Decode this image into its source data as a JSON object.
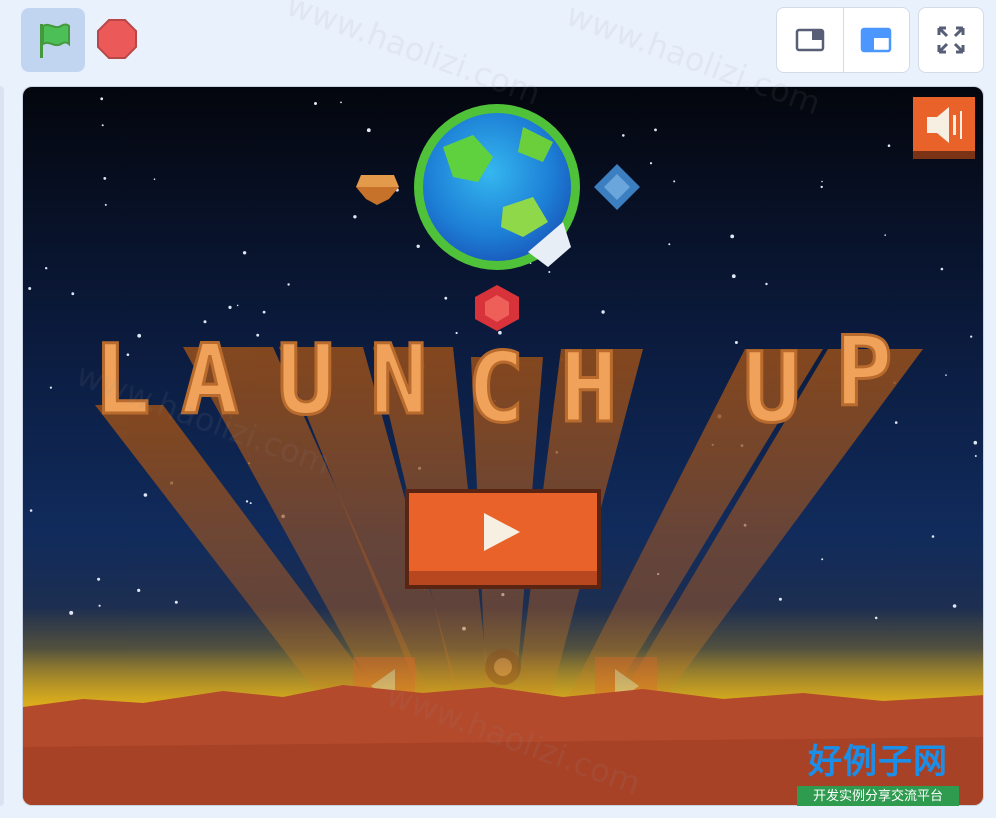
{
  "toolbar": {
    "green_flag": {
      "icon": "green-flag-icon",
      "color": "#4cbf56"
    },
    "stop": {
      "icon": "stop-sign-icon",
      "color": "#ec5959"
    },
    "small_stage": {
      "icon": "small-stage-icon"
    },
    "normal_stage": {
      "icon": "normal-stage-icon",
      "selected": true,
      "accent": "#4c97ff"
    },
    "fullscreen": {
      "icon": "fullscreen-icon"
    }
  },
  "game": {
    "title_letters": [
      "L",
      "A",
      "U",
      "N",
      "C",
      "H",
      " ",
      "U",
      "P"
    ],
    "sound_icon": "speaker-icon",
    "play_icon": "play-icon",
    "nav_left_icon": "arrow-left-icon",
    "nav_right_icon": "arrow-right-icon",
    "colors": {
      "sky_top": "#05070f",
      "sky_mid": "#0e2550",
      "glow": "#f2c21a",
      "ground": "#b44a2c",
      "button": "#e8622a",
      "title": "#f0a25a"
    }
  },
  "watermark": {
    "title": "好例子网",
    "subtitle": "开发实例分享交流平台",
    "url": "www.haolizi.com"
  }
}
